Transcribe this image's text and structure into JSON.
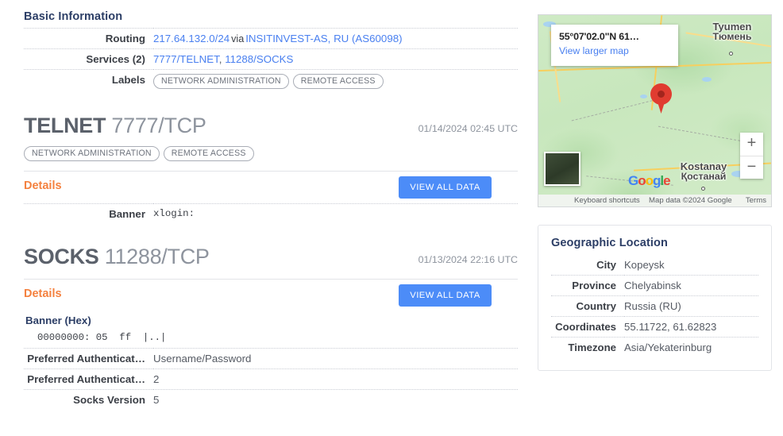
{
  "basic": {
    "title": "Basic Information",
    "rows": [
      {
        "key": "Routing",
        "ip": "217.64.132.0/24",
        "via": "via",
        "asn_name": "INSITINVEST-AS, RU",
        "asn": "AS60098"
      },
      {
        "key": "Services (2)",
        "service1": "7777/TELNET",
        "sep": ",",
        "service2": "11288/SOCKS"
      },
      {
        "key": "Labels",
        "label1": "NETWORK ADMINISTRATION",
        "label2": "REMOTE ACCESS"
      }
    ]
  },
  "services": [
    {
      "protocol": "TELNET",
      "port": "7777/TCP",
      "timestamp": "01/14/2024 02:45 UTC",
      "labels": [
        "NETWORK ADMINISTRATION",
        "REMOTE ACCESS"
      ],
      "details_label": "Details",
      "view_all_label": "VIEW ALL DATA",
      "fields": [
        {
          "key": "Banner",
          "value": "xlogin:",
          "mono": true
        }
      ]
    },
    {
      "protocol": "SOCKS",
      "port": "11288/TCP",
      "timestamp": "01/13/2024 22:16 UTC",
      "labels": [],
      "details_label": "Details",
      "view_all_label": "VIEW ALL DATA",
      "banner_hex_heading": "Banner (Hex)",
      "banner_hex_line": "00000000: 05  ff  |..|",
      "fields": [
        {
          "key": "Preferred Authenticat…",
          "value": "Username/Password",
          "mono": false
        },
        {
          "key": "Preferred Authenticat…",
          "value": "2",
          "mono": false
        },
        {
          "key": "Socks Version",
          "value": "5",
          "mono": false
        }
      ]
    }
  ],
  "map": {
    "coordinates_label": "55°07'02.0\"N 61…",
    "view_larger_map": "View larger map",
    "zoom_in": "+",
    "zoom_out": "−",
    "keyboard_shortcuts": "Keyboard shortcuts",
    "map_data": "Map data ©2024 Google",
    "terms": "Terms",
    "google_logo": [
      "G",
      "o",
      "o",
      "g",
      "l",
      "e"
    ],
    "city_labels": [
      {
        "en": "Tyumen",
        "ru": "Тюмень"
      },
      {
        "en": "Kostanay",
        "ru": "Қостанай"
      }
    ]
  },
  "geographic": {
    "title": "Geographic Location",
    "rows": [
      {
        "key": "City",
        "value": "Kopeysk"
      },
      {
        "key": "Province",
        "value": "Chelyabinsk"
      },
      {
        "key": "Country",
        "value": "Russia (RU)"
      },
      {
        "key": "Coordinates",
        "value": "55.11722, 61.62823"
      },
      {
        "key": "Timezone",
        "value": "Asia/Yekaterinburg"
      }
    ]
  },
  "colors": {
    "link": "#4a80f0",
    "accent_orange": "#f4813f",
    "button_blue": "#4c8cf8",
    "heading_navy": "#2c3e66",
    "pin_red": "#e03c30"
  }
}
